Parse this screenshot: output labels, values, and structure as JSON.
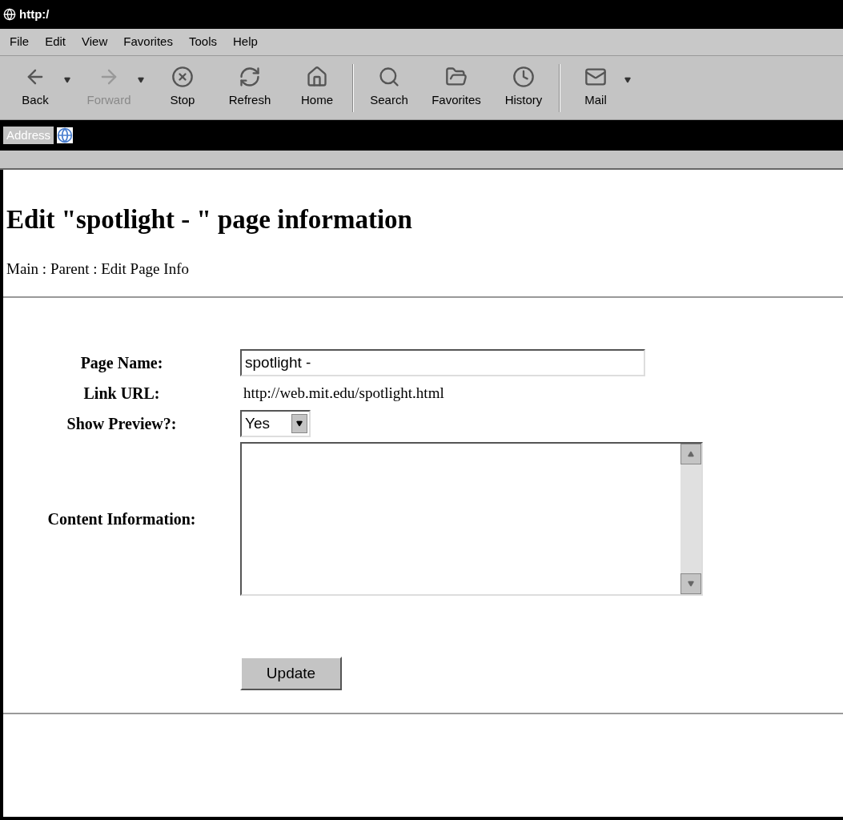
{
  "window": {
    "title": "http:/"
  },
  "menu": [
    "File",
    "Edit",
    "View",
    "Favorites",
    "Tools",
    "Help"
  ],
  "toolbar": [
    {
      "label": "Back",
      "disabled": false,
      "dropdown": true,
      "separator_after": false
    },
    {
      "label": "Forward",
      "disabled": true,
      "dropdown": true,
      "separator_after": false
    },
    {
      "label": "Stop",
      "disabled": false,
      "dropdown": false,
      "separator_after": false
    },
    {
      "label": "Refresh",
      "disabled": false,
      "dropdown": false,
      "separator_after": false
    },
    {
      "label": "Home",
      "disabled": false,
      "dropdown": false,
      "separator_after": true
    },
    {
      "label": "Search",
      "disabled": false,
      "dropdown": false,
      "separator_after": false
    },
    {
      "label": "Favorites",
      "disabled": false,
      "dropdown": false,
      "separator_after": false
    },
    {
      "label": "History",
      "disabled": false,
      "dropdown": false,
      "separator_after": true
    },
    {
      "label": "Mail",
      "disabled": false,
      "dropdown": true,
      "separator_after": false
    }
  ],
  "address_bar": {
    "label": "Address"
  },
  "page": {
    "heading": "Edit \"spotlight - \" page information",
    "breadcrumb": "Main : Parent : Edit Page Info",
    "form": {
      "page_name": {
        "label": "Page Name:",
        "value": "spotlight -"
      },
      "link_url": {
        "label": "Link URL:",
        "value": "http://web.mit.edu/spotlight.html"
      },
      "show_preview": {
        "label": "Show Preview?:",
        "value": "Yes"
      },
      "content_information": {
        "label": "Content Information:"
      },
      "submit": "Update"
    }
  }
}
